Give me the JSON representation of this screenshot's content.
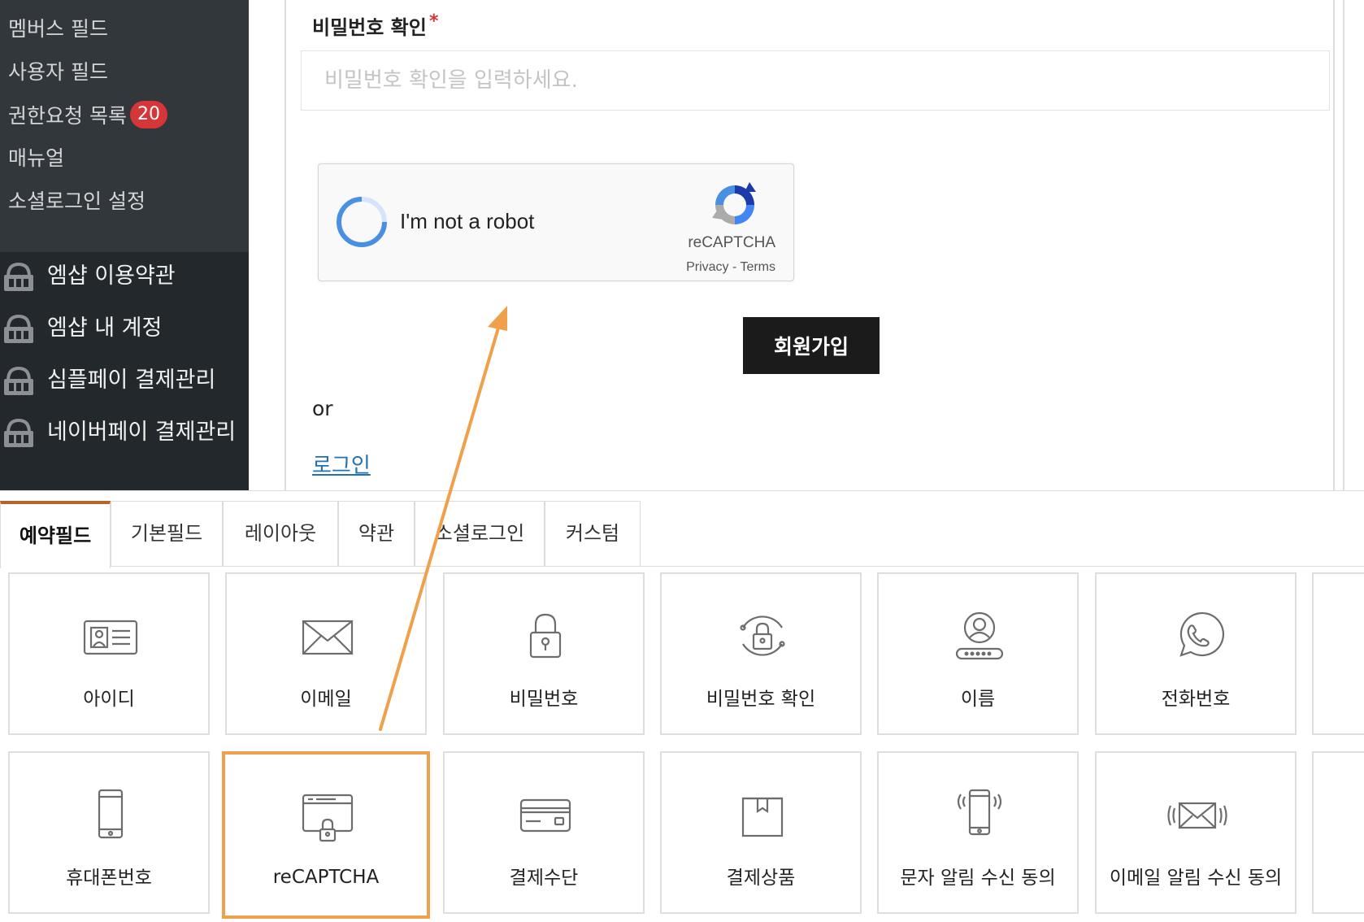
{
  "sidebar": {
    "submenu": [
      {
        "label": "멤버스 필드"
      },
      {
        "label": "사용자 필드"
      },
      {
        "label": "권한요청 목록",
        "badge": "20"
      },
      {
        "label": "매뉴얼"
      },
      {
        "label": "소셜로그인 설정"
      }
    ],
    "menu": [
      {
        "label": "엠샵 이용약관",
        "icon": "mshop-lock-icon"
      },
      {
        "label": "엠샵 내 계정",
        "icon": "mshop-lock-icon"
      },
      {
        "label": "심플페이 결제관리",
        "icon": "mshop-lock-icon"
      },
      {
        "label": "네이버페이 결제관리",
        "icon": "mshop-lock-icon"
      }
    ]
  },
  "form": {
    "password_confirm": {
      "label": "비밀번호 확인",
      "required_mark": "*",
      "placeholder": "비밀번호 확인을 입력하세요."
    },
    "recaptcha": {
      "checkbox_text": "I'm not a robot",
      "brand": "reCAPTCHA",
      "links": "Privacy - Terms"
    },
    "signup_button": "회원가입",
    "or_text": "or",
    "login_link": "로그인"
  },
  "builder": {
    "tabs": [
      {
        "label": "예약필드",
        "active": true
      },
      {
        "label": "기본필드",
        "active": false
      },
      {
        "label": "레이아웃",
        "active": false
      },
      {
        "label": "약관",
        "active": false
      },
      {
        "label": "소셜로그인",
        "active": false
      },
      {
        "label": "커스텀",
        "active": false
      }
    ],
    "fields_row1": [
      {
        "label": "아이디",
        "icon": "id-card-icon"
      },
      {
        "label": "이메일",
        "icon": "envelope-icon"
      },
      {
        "label": "비밀번호",
        "icon": "padlock-icon"
      },
      {
        "label": "비밀번호 확인",
        "icon": "padlock-refresh-icon"
      },
      {
        "label": "이름",
        "icon": "user-name-icon"
      },
      {
        "label": "전화번호",
        "icon": "phone-call-icon"
      }
    ],
    "fields_row2": [
      {
        "label": "휴대폰번호",
        "icon": "mobile-phone-icon"
      },
      {
        "label": "reCAPTCHA",
        "icon": "browser-lock-icon"
      },
      {
        "label": "결제수단",
        "icon": "credit-card-icon"
      },
      {
        "label": "결제상품",
        "icon": "package-box-icon"
      },
      {
        "label": "문자 알림 수신 동의",
        "icon": "phone-signal-icon"
      },
      {
        "label": "이메일 알림 수신 동의",
        "icon": "envelope-signal-icon"
      }
    ]
  },
  "colors": {
    "sidebar_bg": "#23282d",
    "submenu_bg": "#32373c",
    "badge": "#d63638",
    "active_tab_border": "#b7632a",
    "highlight": "#f0a04b",
    "link": "#2271b1"
  }
}
